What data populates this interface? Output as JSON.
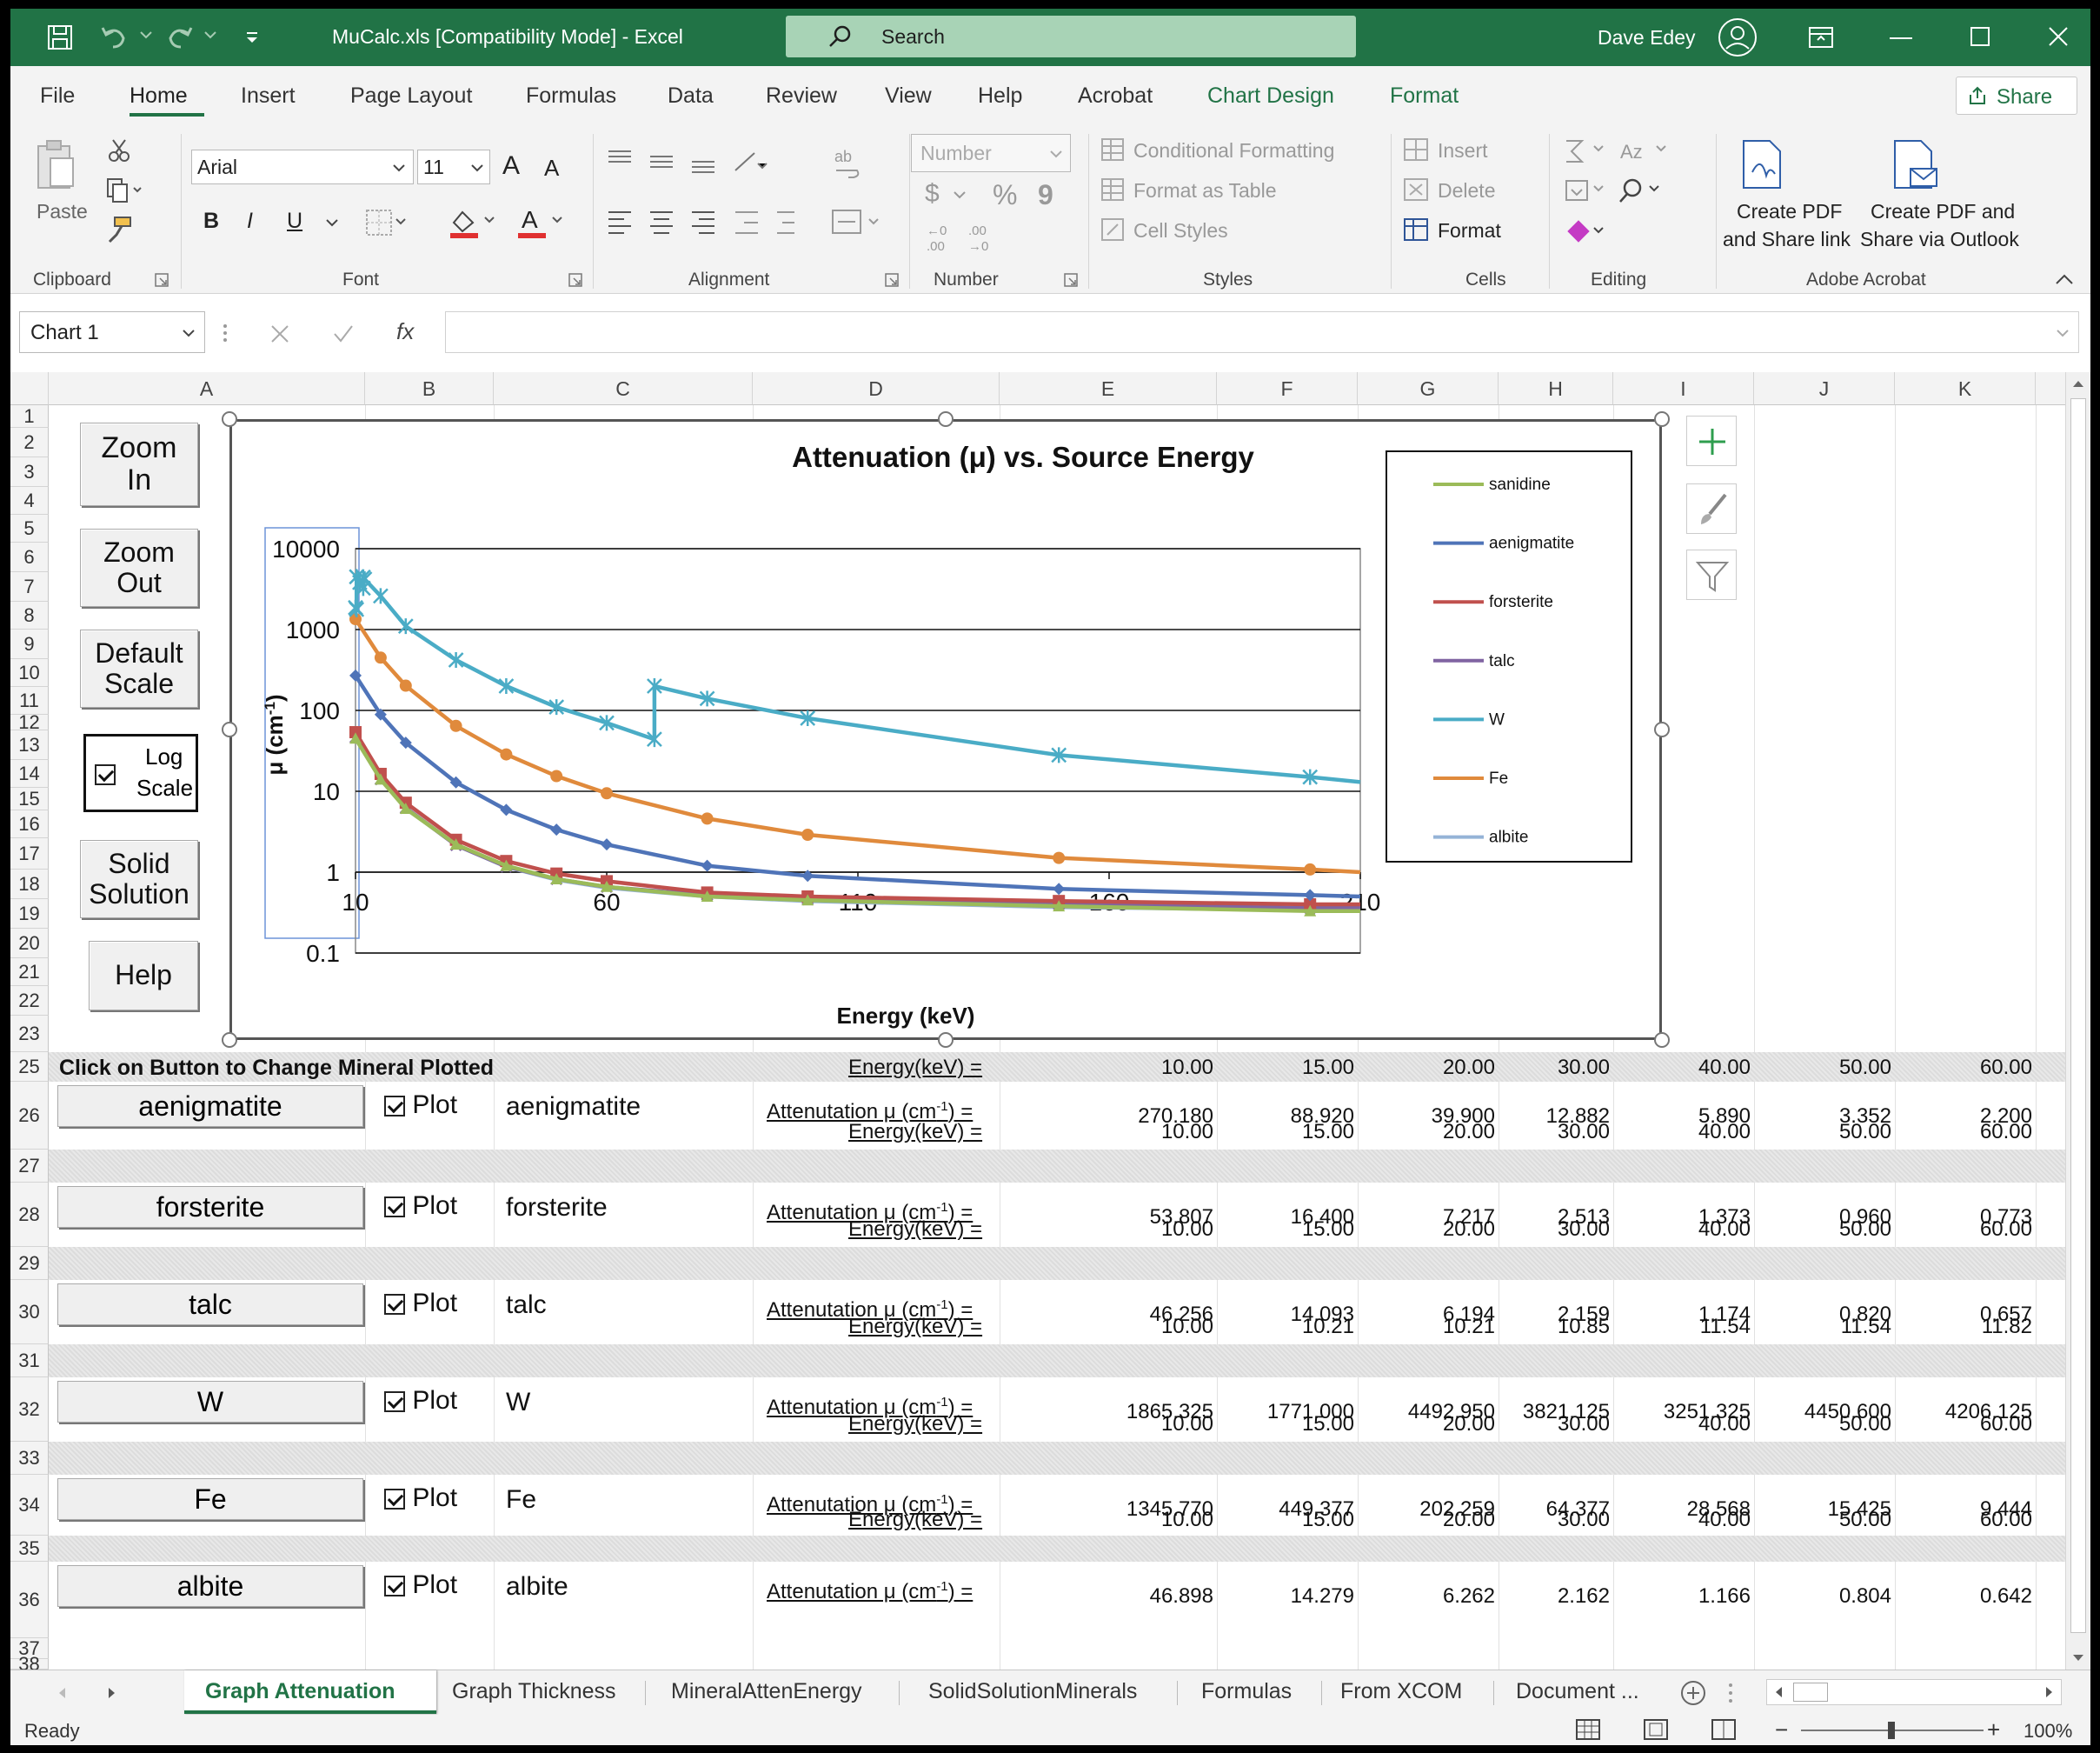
{
  "titlebar": {
    "doc_title": "MuCalc.xls  [Compatibility Mode]  -  Excel",
    "search_placeholder": "Search",
    "user_name": "Dave Edey",
    "qat_icons": [
      "save-icon",
      "undo-icon",
      "redo-icon",
      "customize-icon"
    ]
  },
  "ribbon": {
    "tabs": [
      "File",
      "Home",
      "Insert",
      "Page Layout",
      "Formulas",
      "Data",
      "Review",
      "View",
      "Help",
      "Acrobat",
      "Chart Design",
      "Format"
    ],
    "active_tab": "Home",
    "share": "Share",
    "groups": {
      "clipboard": {
        "label": "Clipboard",
        "paste": "Paste"
      },
      "font": {
        "label": "Font",
        "font_name": "Arial",
        "font_size": "11",
        "bold": "B",
        "italic": "I",
        "underline": "U",
        "grow": "A",
        "shrink": "A"
      },
      "alignment": {
        "label": "Alignment"
      },
      "number": {
        "label": "Number",
        "format": "Number",
        "currency": "$",
        "percent": "%",
        "comma": "9"
      },
      "styles": {
        "label": "Styles",
        "conditional": "Conditional Formatting",
        "format_table": "Format as Table",
        "cell_styles": "Cell Styles"
      },
      "cells": {
        "label": "Cells",
        "insert": "Insert",
        "delete": "Delete",
        "format": "Format"
      },
      "editing": {
        "label": "Editing"
      },
      "acrobat": {
        "label": "Adobe Acrobat",
        "create_pdf_link_1": "Create PDF",
        "create_pdf_link_2": "and Share link",
        "create_pdf_outlook_1": "Create PDF and",
        "create_pdf_outlook_2": "Share via Outlook"
      }
    }
  },
  "formula_bar": {
    "name_box": "Chart 1",
    "fx": "fx",
    "value": ""
  },
  "columns": [
    "A",
    "B",
    "C",
    "D",
    "E",
    "F",
    "G",
    "H",
    "I",
    "J",
    "K"
  ],
  "rows": [
    "1",
    "2",
    "3",
    "4",
    "5",
    "6",
    "7",
    "8",
    "9",
    "10",
    "11",
    "12",
    "13",
    "14",
    "15",
    "16",
    "17",
    "18",
    "19",
    "20",
    "21",
    "22",
    "23",
    "25",
    "26",
    "27",
    "28",
    "29",
    "30",
    "31",
    "32",
    "33",
    "34",
    "35",
    "36",
    "37",
    "38"
  ],
  "side_buttons": {
    "zoom_in_1": "Zoom",
    "zoom_in_2": "In",
    "zoom_out_1": "Zoom",
    "zoom_out_2": "Out",
    "default_1": "Default",
    "default_2": "Scale",
    "log_1": "Log",
    "log_2": "Scale",
    "solid_1": "Solid",
    "solid_2": "Solution",
    "help": "Help"
  },
  "chart_data": {
    "type": "line",
    "title": "Attenuation (μ) vs. Source Energy",
    "xlabel": "Energy (keV)",
    "ylabel": "μ (cm",
    "ylabel_sup": "-1",
    "ylabel_end": ")",
    "y_scale": "log",
    "ylim": [
      0.1,
      10000
    ],
    "xlim": [
      10,
      210
    ],
    "x_ticks": [
      "10",
      "60",
      "110",
      "160",
      "210"
    ],
    "y_ticks": [
      "10000",
      "1000",
      "100",
      "10",
      "1",
      "0.1"
    ],
    "legend_position": "right",
    "series": [
      {
        "name": "sanidine",
        "color": "#9bbb59",
        "marker": "triangle",
        "x": [
          10,
          15,
          20,
          30,
          40,
          50,
          60,
          80,
          100,
          150,
          200,
          210
        ],
        "y": [
          45,
          14,
          6.1,
          2.2,
          1.2,
          0.82,
          0.66,
          0.5,
          0.45,
          0.38,
          0.33,
          0.33
        ]
      },
      {
        "name": "aenigmatite",
        "color": "#4f74b8",
        "marker": "diamond",
        "x": [
          10,
          15,
          20,
          30,
          40,
          50,
          60,
          80,
          100,
          150,
          200,
          210
        ],
        "y": [
          270.18,
          88.92,
          39.9,
          12.882,
          5.89,
          3.352,
          2.2,
          1.2,
          0.9,
          0.62,
          0.52,
          0.5
        ]
      },
      {
        "name": "forsterite",
        "color": "#c0504d",
        "marker": "square",
        "x": [
          10,
          15,
          20,
          30,
          40,
          50,
          60,
          80,
          100,
          150,
          200,
          210
        ],
        "y": [
          53.807,
          16.4,
          7.217,
          2.513,
          1.373,
          0.96,
          0.773,
          0.56,
          0.5,
          0.44,
          0.4,
          0.4
        ]
      },
      {
        "name": "talc",
        "color": "#8064a2",
        "marker": "x",
        "x": [
          10,
          15,
          20,
          30,
          40,
          50,
          60,
          80,
          100,
          150,
          200,
          210
        ],
        "y": [
          46.256,
          14.093,
          6.194,
          2.159,
          1.174,
          0.82,
          0.657,
          0.52,
          0.46,
          0.4,
          0.36,
          0.36
        ]
      },
      {
        "name": "W",
        "color": "#4aacc6",
        "marker": "star",
        "x": [
          10,
          10.21,
          10.21,
          10.85,
          11.54,
          11.54,
          11.82,
          15,
          20,
          30,
          40,
          50,
          60,
          69.5,
          69.5,
          80,
          100,
          150,
          200,
          210
        ],
        "y": [
          1865.325,
          1771,
          4492.95,
          3821.125,
          3251.325,
          4450.6,
          4206.125,
          2600,
          1100,
          420,
          200,
          110,
          70,
          44,
          200,
          140,
          80,
          28,
          15,
          13
        ]
      },
      {
        "name": "Fe",
        "color": "#e08a3c",
        "marker": "circle",
        "x": [
          10,
          15,
          20,
          30,
          40,
          50,
          60,
          80,
          100,
          150,
          200,
          210
        ],
        "y": [
          1345.77,
          449.377,
          202.259,
          64.377,
          28.568,
          15.425,
          9.444,
          4.6,
          2.9,
          1.5,
          1.08,
          1.0
        ]
      },
      {
        "name": "albite",
        "color": "#95b3d7",
        "marker": "none",
        "x": [
          10,
          15,
          20,
          30,
          40,
          50,
          60,
          80,
          100,
          150,
          200,
          210
        ],
        "y": [
          46.898,
          14.279,
          6.262,
          2.162,
          1.166,
          0.804,
          0.642,
          0.5,
          0.44,
          0.37,
          0.34,
          0.33
        ]
      }
    ]
  },
  "table": {
    "header_note": "Click on Button to Change Mineral Plotted",
    "energy_label": "Energy(keV) =",
    "atten_label": "Attenutation μ (cm",
    "atten_sup": "-1",
    "atten_end": ") =",
    "plot_label": "Plot",
    "blocks": [
      {
        "button": "aenigmatite",
        "name": "aenigmatite",
        "energy": [
          "10.00",
          "15.00",
          "20.00",
          "30.00",
          "40.00",
          "50.00",
          "60.00"
        ],
        "mu": [
          "270.180",
          "88.920",
          "39.900",
          "12.882",
          "5.890",
          "3.352",
          "2.200"
        ]
      },
      {
        "button": "forsterite",
        "name": "forsterite",
        "energy": [
          "10.00",
          "15.00",
          "20.00",
          "30.00",
          "40.00",
          "50.00",
          "60.00"
        ],
        "mu": [
          "53.807",
          "16.400",
          "7.217",
          "2.513",
          "1.373",
          "0.960",
          "0.773"
        ]
      },
      {
        "button": "talc",
        "name": "talc",
        "energy": [
          "10.00",
          "15.00",
          "20.00",
          "30.00",
          "40.00",
          "50.00",
          "60.00"
        ],
        "mu": [
          "46.256",
          "14.093",
          "6.194",
          "2.159",
          "1.174",
          "0.820",
          "0.657"
        ]
      },
      {
        "button": "W",
        "name": "W",
        "energy": [
          "10.00",
          "10.21",
          "10.21",
          "10.85",
          "11.54",
          "11.54",
          "11.82"
        ],
        "mu": [
          "1865.325",
          "1771.000",
          "4492.950",
          "3821.125",
          "3251.325",
          "4450.600",
          "4206.125"
        ]
      },
      {
        "button": "Fe",
        "name": "Fe",
        "energy": [
          "10.00",
          "15.00",
          "20.00",
          "30.00",
          "40.00",
          "50.00",
          "60.00"
        ],
        "mu": [
          "1345.770",
          "449.377",
          "202.259",
          "64.377",
          "28.568",
          "15.425",
          "9.444"
        ]
      },
      {
        "button": "albite",
        "name": "albite",
        "energy": [
          "10.00",
          "15.00",
          "20.00",
          "30.00",
          "40.00",
          "50.00",
          "60.00"
        ],
        "mu": [
          "46.898",
          "14.279",
          "6.262",
          "2.162",
          "1.166",
          "0.804",
          "0.642"
        ]
      }
    ]
  },
  "sheet_tabs": [
    "Graph Attenuation",
    "Graph Thickness",
    "MineralAttenEnergy",
    "SolidSolutionMinerals",
    "Formulas",
    "From XCOM",
    "Document ..."
  ],
  "active_sheet": "Graph Attenuation",
  "status": {
    "ready": "Ready",
    "zoom": "100%"
  }
}
